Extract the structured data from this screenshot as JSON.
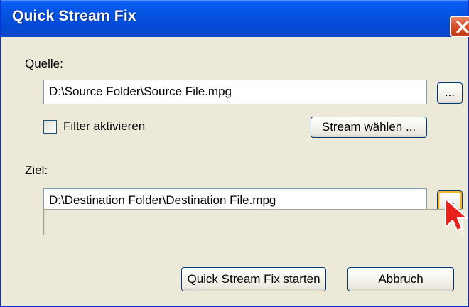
{
  "window": {
    "title": "Quick Stream Fix",
    "close_label": "X"
  },
  "source": {
    "label": "Quelle:",
    "path": "D:\\Source Folder\\Source File.mpg",
    "browse_label": "...",
    "filter_label": "Filter aktivieren",
    "filter_checked": false,
    "select_stream_label": "Stream wählen ..."
  },
  "destination": {
    "label": "Ziel:",
    "path": "D:\\Destination Folder\\Destination File.mpg",
    "browse_label": "..."
  },
  "progress": {
    "value": 0
  },
  "actions": {
    "start_label": "Quick Stream Fix starten",
    "cancel_label": "Abbruch"
  },
  "icons": {
    "close": "close-icon",
    "cursor": "mouse-pointer-icon"
  },
  "colors": {
    "titlebar": "#0553e0",
    "close_button": "#d9502a",
    "cursor": "#e8221b",
    "face": "#ece9d8"
  }
}
